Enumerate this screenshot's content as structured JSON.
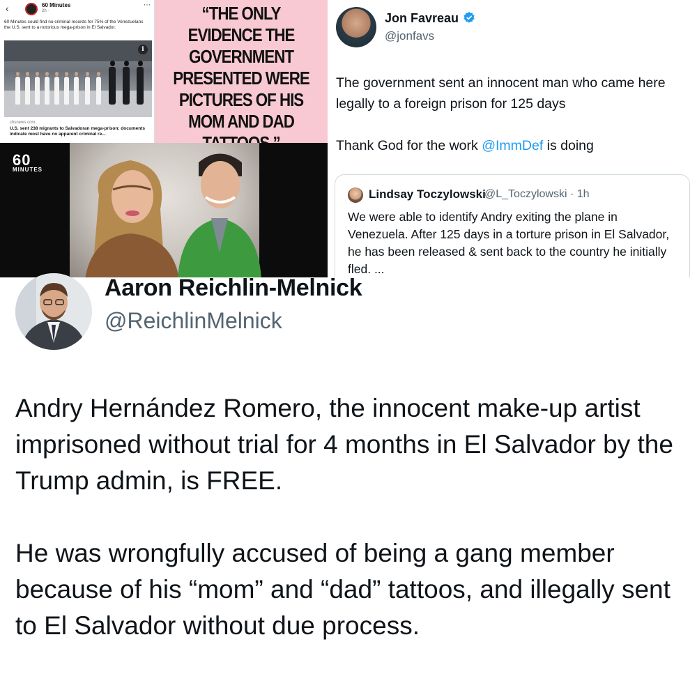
{
  "collage": {
    "fb_card": {
      "back_icon": "back-arrow-icon",
      "page_name": "60 Minutes",
      "time": "2h · ",
      "more_icon": "more-dots-icon",
      "post_text": "60 Minutes could find no criminal records for 75% of the Venezuelans the U.S. sent to a notorious mega-prison in El Salvador.",
      "info_icon": "info-icon",
      "link_source": "cbsnews.com",
      "link_headline": "U.S. sent 238 migrants to Salvadoran mega-prison; documents indicate most have no apparent criminal re..."
    },
    "quote_card": {
      "text": "“THE ONLY EVIDENCE THE GOVERNMENT PRESENTED WERE PICTURES OF HIS MOM AND DAD TATTOOS.”",
      "background": "#f9c9d3"
    },
    "tv_card": {
      "logo_number": "60",
      "logo_word": "MINUTES"
    }
  },
  "jon_tweet": {
    "name": "Jon Favreau",
    "handle": "@jonfavs",
    "verified_icon": "verified-badge-icon",
    "text_line1": "The government sent an innocent man who came here legally to a foreign prison for 125 days",
    "text_line2_before": "Thank God for the work ",
    "text_line2_mention": "@ImmDef",
    "text_line2_after": " is doing",
    "quoted": {
      "name": "Lindsay Toczylowski",
      "handle_time": "@L_Toczylowski · 1h",
      "text": "We were able to identify Andry exiting the plane in Venezuela. After 125 days in a torture prison in El Salvador, he has been released & sent back to the country he initially fled. ..."
    }
  },
  "main_tweet": {
    "name": "Aaron Reichlin-Melnick",
    "handle": "@ReichlinMelnick",
    "paragraph1": "Andry Hernández Romero, the innocent make-up artist imprisoned without trial for 4 months in El Salvador by the Trump admin, is FREE.",
    "paragraph2": "He was wrongfully accused of being a gang member because of his “mom” and “dad” tattoos, and illegally sent to El Salvador without due process."
  },
  "colors": {
    "link_blue": "#1d9bf0",
    "secondary_text": "#536471",
    "primary_text": "#0f1419"
  }
}
